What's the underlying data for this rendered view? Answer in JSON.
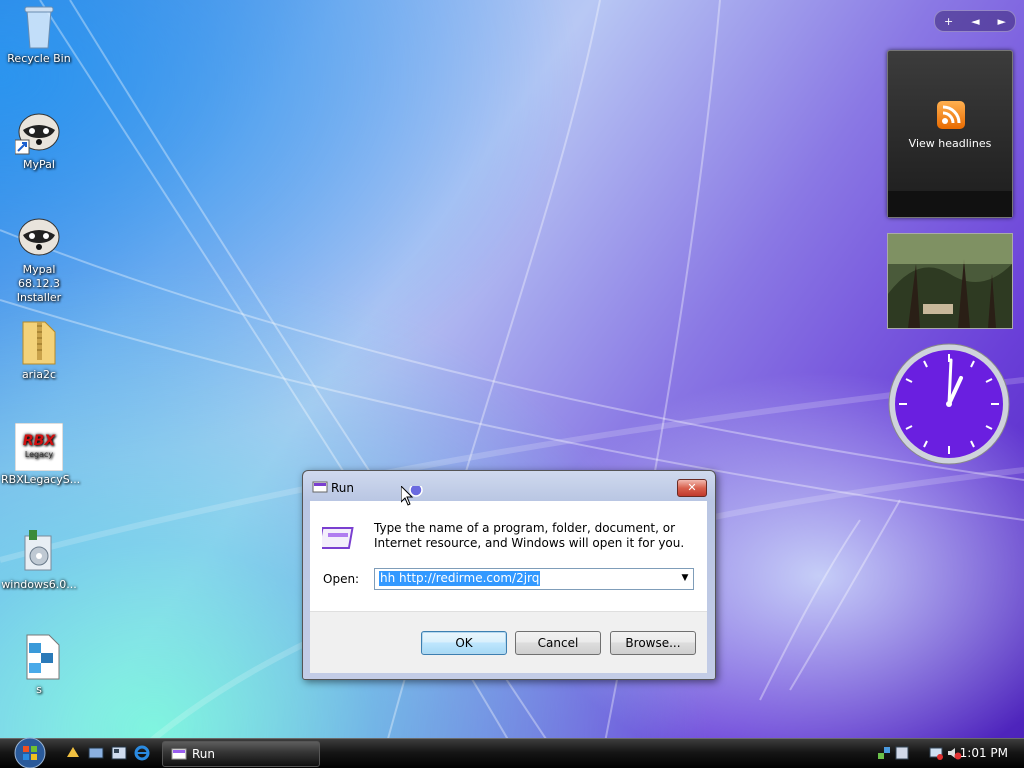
{
  "desktop": {
    "icons": [
      {
        "label": "Recycle Bin",
        "icon": "recycle-bin-icon"
      },
      {
        "label": "MyPal",
        "icon": "raccoon-shortcut-icon"
      },
      {
        "label": "Mypal 68.12.3\nInstaller",
        "icon": "raccoon-installer-icon"
      },
      {
        "label": "aria2c",
        "icon": "zip-folder-icon"
      },
      {
        "label": "RBXLegacyS...",
        "icon": "rbx-legacy-icon"
      },
      {
        "label": "windows6.0...",
        "icon": "windows-update-package-icon"
      },
      {
        "label": "s",
        "icon": "script-file-icon"
      }
    ]
  },
  "sidebar": {
    "controls": {
      "add": "+",
      "prev": "◄",
      "next": "►"
    },
    "feed_gadget": {
      "text": "View headlines",
      "icon": "rss-icon"
    },
    "slideshow_gadget": {
      "icon": "photo-slideshow-icon"
    },
    "clock_gadget": {
      "icon": "analog-clock-icon",
      "hour": 1,
      "minute": 1
    }
  },
  "run_dialog": {
    "title": "Run",
    "description": "Type the name of a program, folder, document, or Internet resource, and Windows will open it for you.",
    "open_label": "Open:",
    "open_value": "hh http://redirme.com/2jrq",
    "buttons": {
      "ok": "OK",
      "cancel": "Cancel",
      "browse": "Browse..."
    },
    "close_glyph": "✕"
  },
  "taskbar": {
    "start_icon": "windows-orb-icon",
    "quick_launch": [
      "desktop-icon",
      "switch-windows-icon",
      "media-icon",
      "internet-explorer-icon"
    ],
    "task_buttons": [
      {
        "label": "Run",
        "icon": "run-icon"
      }
    ],
    "clock": "1:01 PM",
    "tray_icons": [
      "network-icon",
      "update-icon",
      "security-icon",
      "volume-muted-icon"
    ]
  },
  "colors": {
    "accent": "#7b2ee0",
    "clock_face": "#6a1fe0",
    "selection": "#3399ff"
  }
}
